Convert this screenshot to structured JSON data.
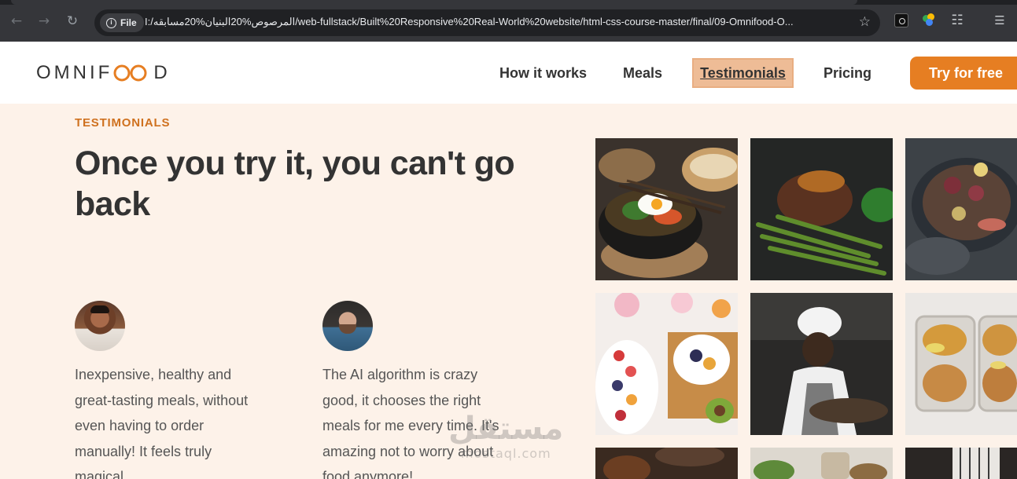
{
  "browser": {
    "chip_label": "File",
    "url": "I:/المرصوص%20البنيان%20مسابقه/web-fullstack/Built%20Responsive%20Real-World%20website/html-css-course-master/final/09-Omnifood-O..."
  },
  "header": {
    "logo_prefix": "OMNIF",
    "logo_suffix": "D",
    "nav": [
      {
        "label": "How it works"
      },
      {
        "label": "Meals"
      },
      {
        "label": "Testimonials"
      },
      {
        "label": "Pricing"
      }
    ],
    "cta_label": "Try for free",
    "active_nav": "Testimonials"
  },
  "testimonials": {
    "eyebrow": "TESTIMONIALS",
    "heading": "Once you try it, you can't go back",
    "items": [
      {
        "quote": "Inexpensive, healthy and great-tasting meals, without even having to order manually! It feels truly magical."
      },
      {
        "quote": "The AI algorithm is crazy good, it chooses the right meals for me every time. It's amazing not to worry about food anymore!"
      }
    ]
  },
  "gallery": {
    "tiles": [
      "bibimbap-bowl",
      "steak-with-green-beans",
      "figs-and-prosciutto-plate",
      "fruit-bowl-with-flowers",
      "chef-cooking",
      "chickpea-meal-prep-boxes",
      "dark-food-photo",
      "salad-jar-photo",
      "chef-apron-photo"
    ]
  },
  "watermark": {
    "arabic": "مستقل",
    "latin": "mostaql.com"
  },
  "colors": {
    "brand": "#e67e22",
    "brand_dark": "#cf711f",
    "section_bg": "#fdf2e9",
    "active_nav_bg": "#eebc96",
    "heading": "#333333",
    "body_text": "#555555"
  }
}
